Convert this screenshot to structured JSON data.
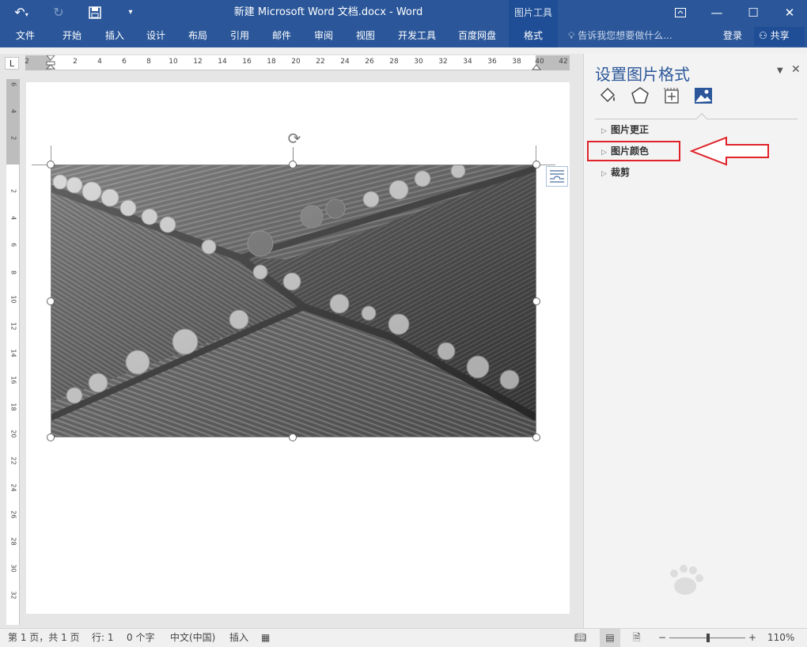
{
  "titlebar": {
    "title": "新建 Microsoft Word 文档.docx - Word",
    "context_tab_group": "图片工具",
    "undo_icon": "undo-icon",
    "redo_icon": "redo-icon",
    "save_icon": "save-icon",
    "customize_icon": "qat-customize-icon",
    "window_buttons": [
      "ribbon-display-options-icon",
      "minimize-icon",
      "maximize-icon",
      "close-icon"
    ]
  },
  "ribbon": {
    "tabs": [
      {
        "label": "文件"
      },
      {
        "label": "开始"
      },
      {
        "label": "插入"
      },
      {
        "label": "设计"
      },
      {
        "label": "布局"
      },
      {
        "label": "引用"
      },
      {
        "label": "邮件"
      },
      {
        "label": "审阅"
      },
      {
        "label": "视图"
      },
      {
        "label": "开发工具"
      },
      {
        "label": "百度网盘"
      },
      {
        "label": "格式",
        "active": true
      }
    ],
    "tell_me": "告诉我您想要做什么...",
    "login": "登录",
    "share": "共享"
  },
  "ruler": {
    "corner": "L",
    "h_labels": [
      "2",
      "",
      "2",
      "4",
      "6",
      "8",
      "10",
      "12",
      "14",
      "16",
      "18",
      "20",
      "22",
      "24",
      "26",
      "28",
      "30",
      "32",
      "34",
      "36",
      "38",
      "40",
      "42"
    ],
    "v_labels": [
      "6",
      "4",
      "2",
      "",
      "2",
      "4",
      "6",
      "8",
      "10",
      "12",
      "14",
      "16",
      "18",
      "20",
      "22",
      "24",
      "26",
      "28",
      "30",
      "32"
    ]
  },
  "pane": {
    "title": "设置图片格式",
    "dropdown_icon": "pane-options-icon",
    "close_icon": "close-icon",
    "category_icons": [
      "fill-line-icon",
      "effects-icon",
      "layout-properties-icon",
      "picture-icon"
    ],
    "sections": [
      {
        "label": "图片更正"
      },
      {
        "label": "图片颜色"
      },
      {
        "label": "裁剪"
      }
    ]
  },
  "statusbar": {
    "page": "第 1 页，共 1 页",
    "line": "行: 1",
    "words": "0 个字",
    "language": "中文(中国)",
    "mode": "插入",
    "zoom_minus": "−",
    "zoom_plus": "+",
    "zoom": "110%"
  },
  "colors": {
    "brand": "#2b579a",
    "annotation_red": "#e0232a"
  }
}
